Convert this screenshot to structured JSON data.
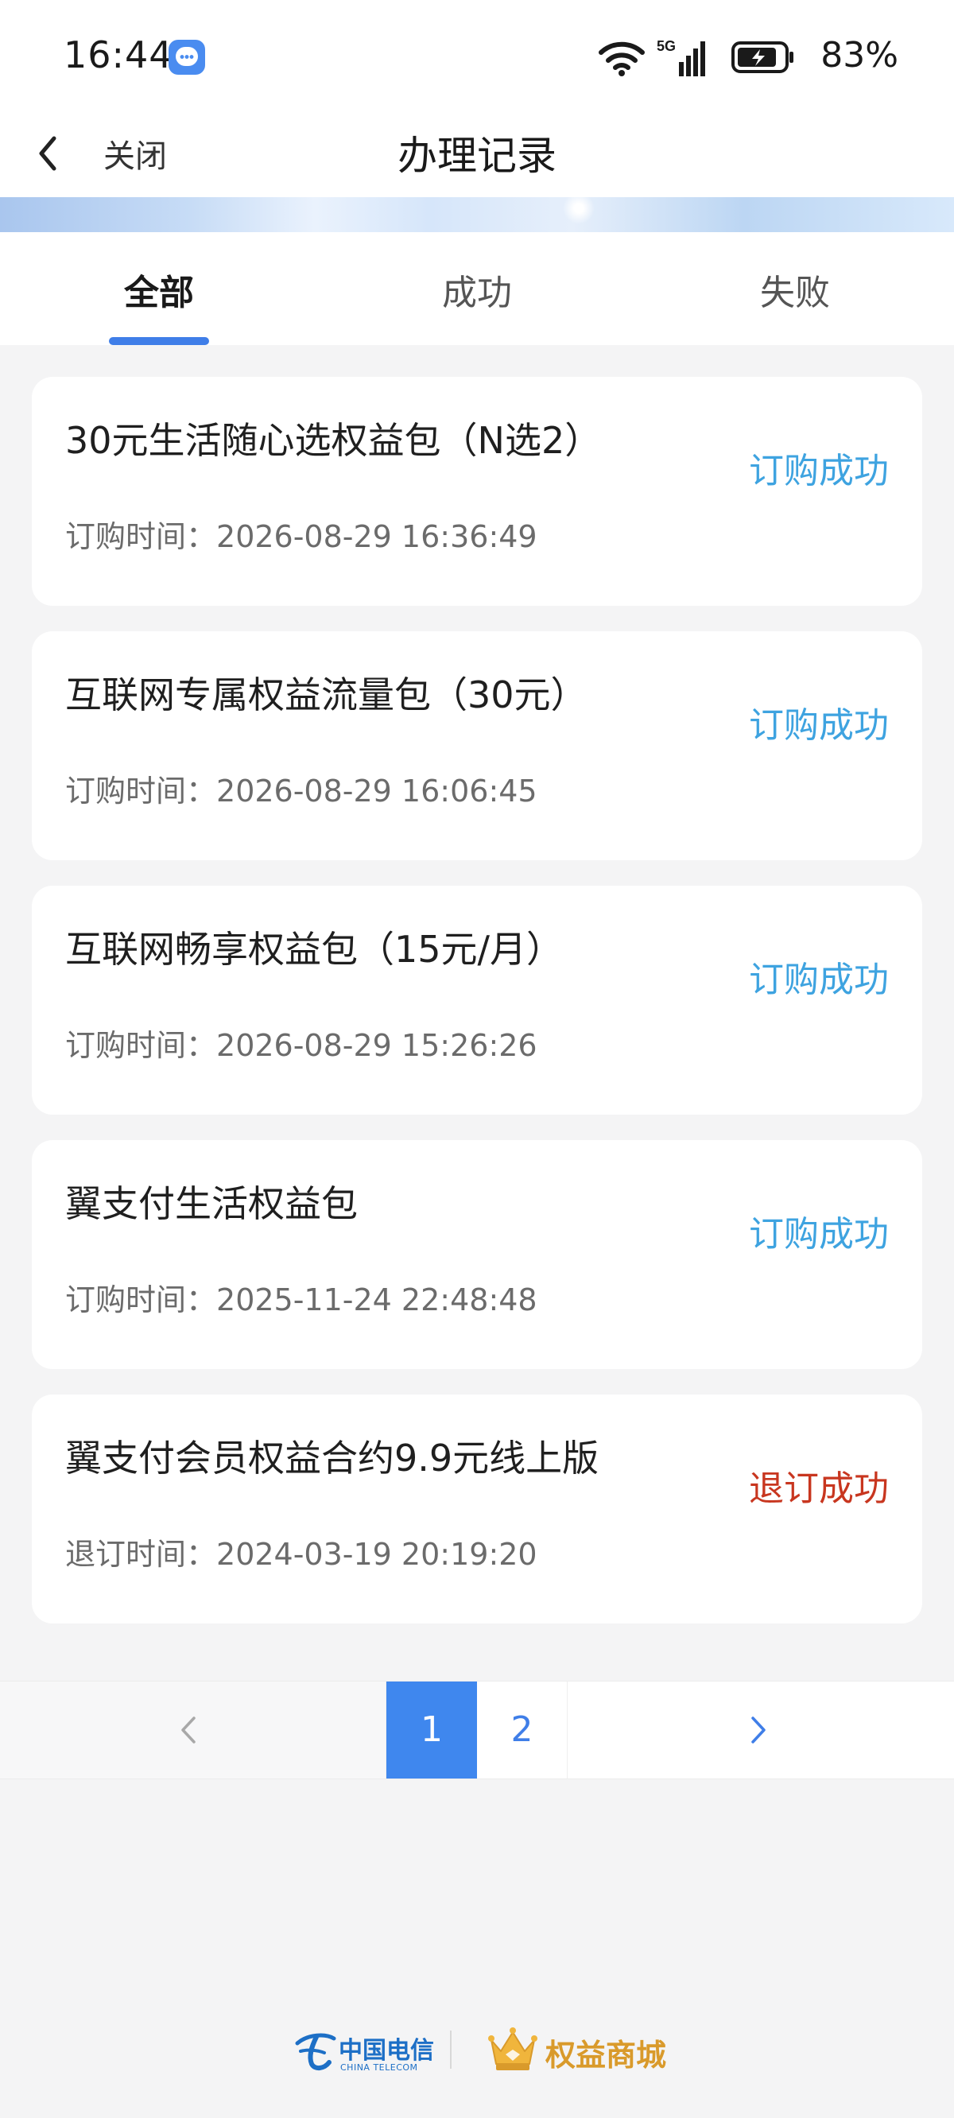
{
  "status_bar": {
    "time": "16:44",
    "network": "5G",
    "battery": "83%"
  },
  "nav": {
    "close_label": "关闭",
    "title": "办理记录"
  },
  "tabs": [
    {
      "label": "全部",
      "active": true
    },
    {
      "label": "成功",
      "active": false
    },
    {
      "label": "失败",
      "active": false
    }
  ],
  "records": [
    {
      "title": "30元生活随心选权益包（N选2）",
      "time_label": "订购时间：",
      "time": "2026-08-29 16:36:49",
      "status": "订购成功"
    },
    {
      "title": "互联网专属权益流量包（30元）",
      "time_label": "订购时间：",
      "time": "2026-08-29 16:06:45",
      "status": "订购成功"
    },
    {
      "title": "互联网畅享权益包（15元/月）",
      "time_label": "订购时间：",
      "time": "2026-08-29 15:26:26",
      "status": "订购成功"
    },
    {
      "title": "翼支付生活权益包",
      "time_label": "订购时间：",
      "time": "2025-11-24 22:48:48",
      "status": "订购成功"
    },
    {
      "title": "翼支付会员权益合约9.9元线上版",
      "time_label": "退订时间：",
      "time": "2024-03-19 20:19:20",
      "status": "退订成功"
    }
  ],
  "pagination": {
    "pages": [
      "1",
      "2"
    ],
    "current": "1"
  },
  "footer": {
    "operator_cn": "中国电信",
    "operator_en": "CHINA TELECOM",
    "mall_label": "权益商城"
  },
  "colors": {
    "accent": "#3f7ee8",
    "status_success": "#3ea3e0",
    "status_unsubscribed": "#c8361f",
    "mall_gold": "#d99a2b"
  }
}
